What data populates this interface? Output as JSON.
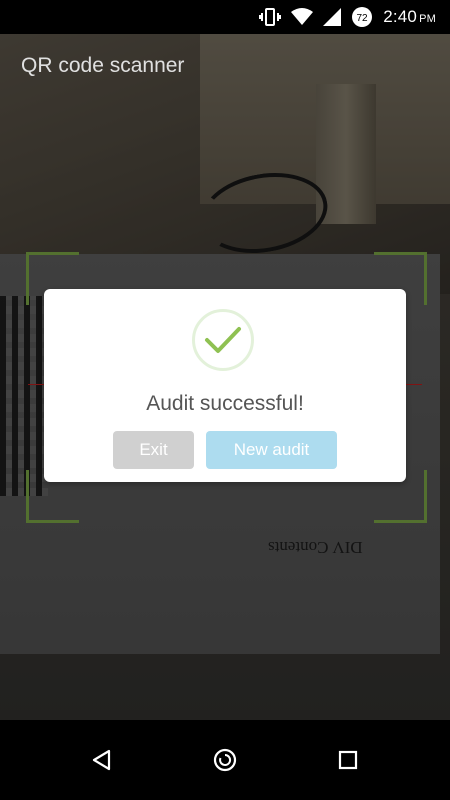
{
  "status_bar": {
    "time": "2:40",
    "ampm": "PM",
    "battery_level": "72",
    "icons": [
      "vibrate-icon",
      "wifi-icon",
      "cell-signal-icon",
      "battery-icon"
    ]
  },
  "app": {
    "title": "QR code scanner"
  },
  "camera_scene": {
    "paper_text": "DIV Contents"
  },
  "dialog": {
    "icon": "checkmark-icon",
    "message": "Audit successful!",
    "exit_label": "Exit",
    "new_audit_label": "New audit"
  },
  "colors": {
    "frame_accent": "#8fc152",
    "check_color": "#8fc152",
    "exit_button": "#d0d0d0",
    "new_audit_button": "#addcef",
    "scan_line": "#dd2222"
  },
  "nav_bar": {
    "icons": [
      "back-icon",
      "home-icon",
      "recents-icon"
    ]
  }
}
